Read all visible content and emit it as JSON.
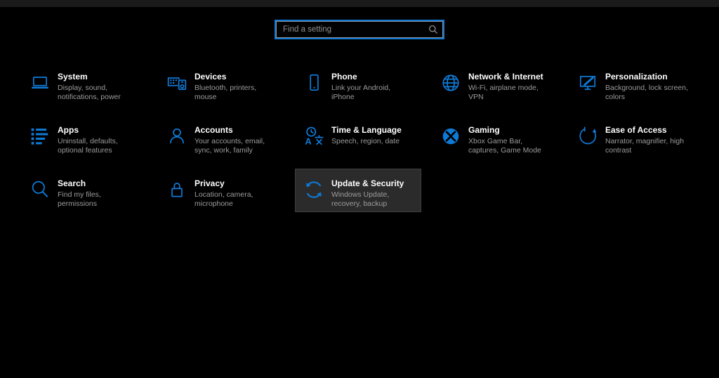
{
  "window": {
    "titlebar": ""
  },
  "accent_color": "#0f7ad6",
  "background_color": "#000000",
  "search": {
    "placeholder": "Find a setting"
  },
  "tiles": [
    {
      "title": "System",
      "subtitle": "Display, sound, notifications, power",
      "icon": "laptop-icon"
    },
    {
      "title": "Devices",
      "subtitle": "Bluetooth, printers, mouse",
      "icon": "devices-icon"
    },
    {
      "title": "Phone",
      "subtitle": "Link your Android, iPhone",
      "icon": "phone-icon"
    },
    {
      "title": "Network & Internet",
      "subtitle": "Wi-Fi, airplane mode, VPN",
      "icon": "globe-icon"
    },
    {
      "title": "Personalization",
      "subtitle": "Background, lock screen, colors",
      "icon": "personalization-icon"
    },
    {
      "title": "Apps",
      "subtitle": "Uninstall, defaults, optional features",
      "icon": "apps-list-icon"
    },
    {
      "title": "Accounts",
      "subtitle": "Your accounts, email, sync, work, family",
      "icon": "person-icon"
    },
    {
      "title": "Time & Language",
      "subtitle": "Speech, region, date",
      "icon": "time-language-icon"
    },
    {
      "title": "Gaming",
      "subtitle": "Xbox Game Bar, captures, Game Mode",
      "icon": "xbox-icon"
    },
    {
      "title": "Ease of Access",
      "subtitle": "Narrator, magnifier, high contrast",
      "icon": "ease-of-access-icon"
    },
    {
      "title": "Search",
      "subtitle": "Find my files, permissions",
      "icon": "search-icon"
    },
    {
      "title": "Privacy",
      "subtitle": "Location, camera, microphone",
      "icon": "lock-icon"
    },
    {
      "title": "Update & Security",
      "subtitle": "Windows Update, recovery, backup",
      "icon": "sync-icon",
      "state": "hovered"
    }
  ]
}
